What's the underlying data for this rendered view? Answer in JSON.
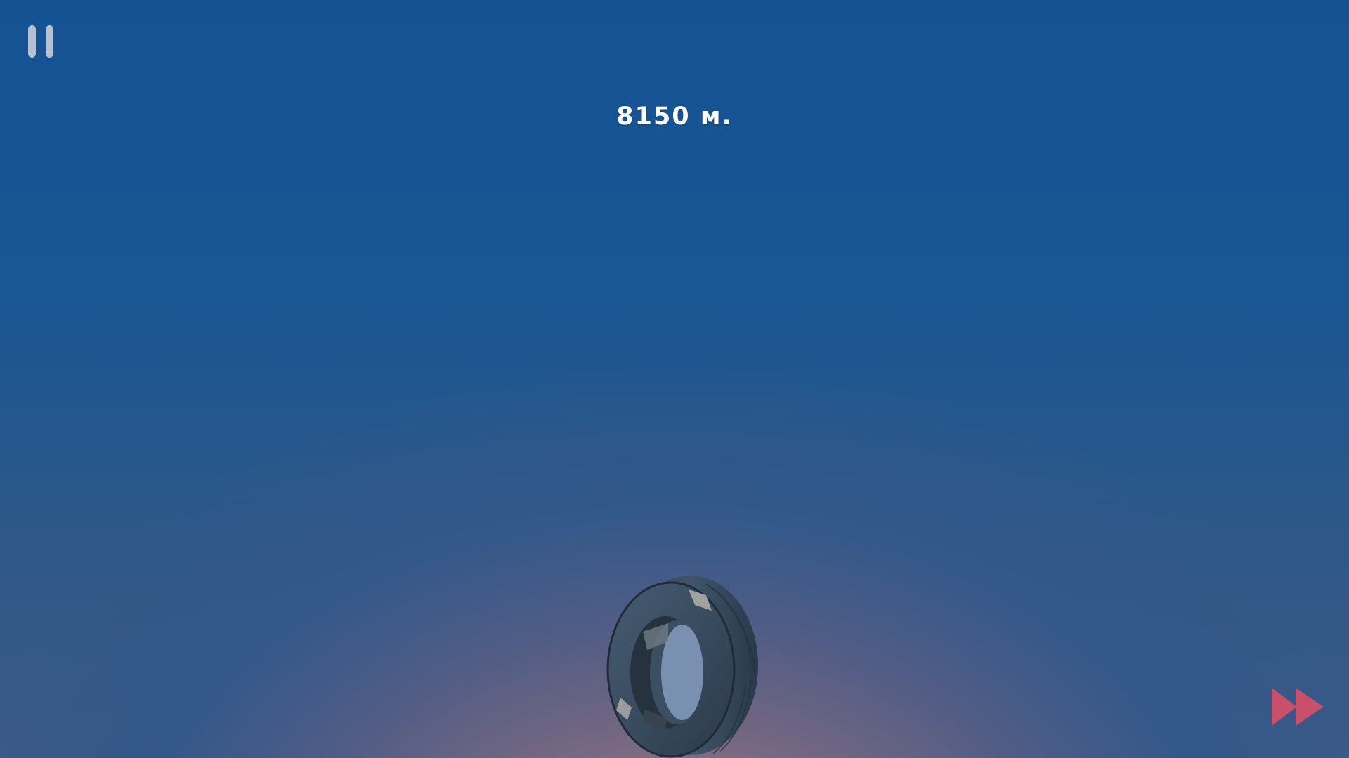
{
  "hud": {
    "distance_text": "8150 м."
  },
  "icons": {
    "pause": "pause-icon",
    "fast_forward": "fast-forward-icon"
  },
  "colors": {
    "sky_top": "#155294",
    "horizon_glow": "#a87a86",
    "pause_icon": "#b6c0d3",
    "fast_forward_icon": "#c9506a",
    "distance_text": "#ffffff"
  }
}
